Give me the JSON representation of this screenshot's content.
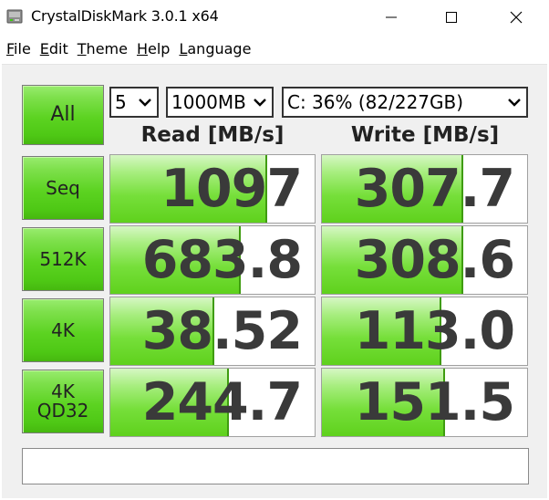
{
  "window": {
    "title": "CrystalDiskMark 3.0.1 x64",
    "icons": {
      "app": "disk-icon",
      "minimize": "minimize-icon",
      "maximize": "maximize-icon",
      "close": "close-icon"
    }
  },
  "menu": [
    {
      "underline": "F",
      "rest": "ile"
    },
    {
      "underline": "E",
      "rest": "dit"
    },
    {
      "underline": "T",
      "rest": "heme"
    },
    {
      "underline": "H",
      "rest": "elp"
    },
    {
      "underline": "L",
      "rest": "anguage"
    }
  ],
  "controls": {
    "all_label": "All",
    "count": "5",
    "size": "1000MB",
    "drive": "C: 36% (82/227GB)"
  },
  "headers": {
    "read": "Read [MB/s]",
    "write": "Write [MB/s]"
  },
  "rows": [
    {
      "label_line1": "Seq",
      "label_line2": "",
      "read": "1097",
      "write": "307.7",
      "read_fill": 0.77,
      "write_fill": 0.69
    },
    {
      "label_line1": "512K",
      "label_line2": "",
      "read": "683.8",
      "write": "308.6",
      "read_fill": 0.64,
      "write_fill": 0.69
    },
    {
      "label_line1": "4K",
      "label_line2": "",
      "read": "38.52",
      "write": "113.0",
      "read_fill": 0.51,
      "write_fill": 0.58
    },
    {
      "label_line1": "4K",
      "label_line2": "QD32",
      "read": "244.7",
      "write": "151.5",
      "read_fill": 0.58,
      "write_fill": 0.6
    }
  ],
  "status": {
    "text": ""
  },
  "colors": {
    "accent": "#5cd321",
    "value_text": "#3a3a3a",
    "bar_edge": "#3f9c10"
  }
}
